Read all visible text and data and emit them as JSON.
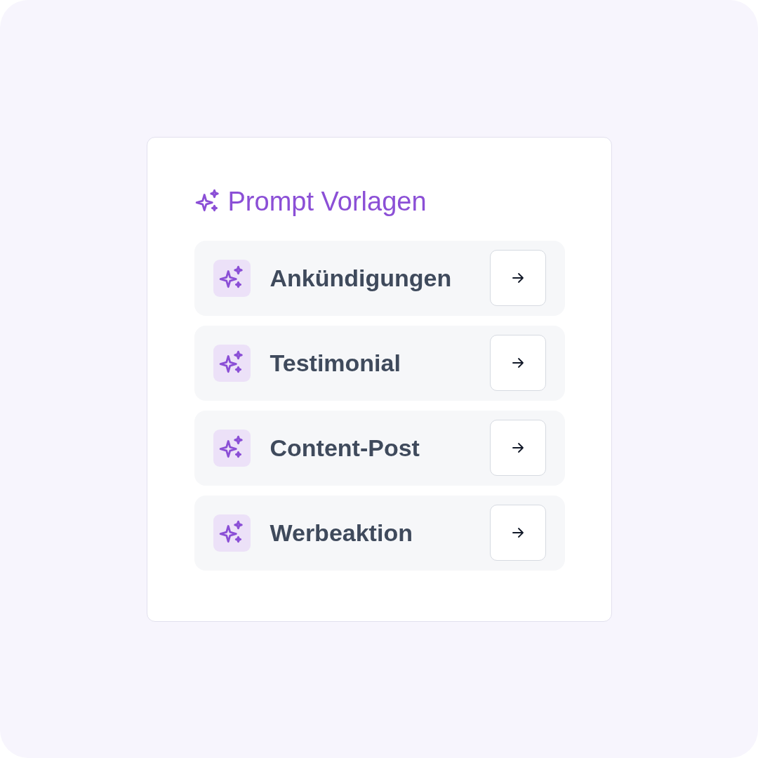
{
  "panel": {
    "title": "Prompt Vorlagen",
    "templates": [
      {
        "label": "Ankündigungen"
      },
      {
        "label": "Testimonial"
      },
      {
        "label": "Content-Post"
      },
      {
        "label": "Werbeaktion"
      }
    ]
  }
}
